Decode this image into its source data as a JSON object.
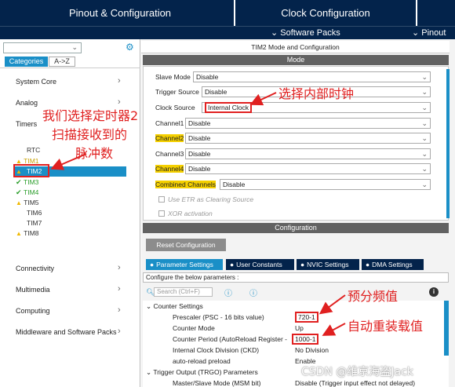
{
  "tabs": {
    "pinout": "Pinout & Configuration",
    "clock": "Clock Configuration"
  },
  "subbar": {
    "software_packs": "Software Packs",
    "pinout": "Pinout"
  },
  "left": {
    "tab_categories": "Categories",
    "tab_az": "A->Z",
    "categories": [
      "System Core",
      "Analog",
      "Timers",
      "Connectivity",
      "Multimedia",
      "Computing",
      "Middleware and Software Packs"
    ],
    "peripherals": [
      {
        "name": "RTC",
        "status": "none"
      },
      {
        "name": "TIM1",
        "status": "warn"
      },
      {
        "name": "TIM2",
        "status": "warn"
      },
      {
        "name": "TIM3",
        "status": "ok"
      },
      {
        "name": "TIM4",
        "status": "ok"
      },
      {
        "name": "TIM5",
        "status": "warn"
      },
      {
        "name": "TIM6",
        "status": "none"
      },
      {
        "name": "TIM7",
        "status": "none"
      },
      {
        "name": "TIM8",
        "status": "warn"
      }
    ]
  },
  "mode": {
    "header": "TIM2 Mode and Configuration",
    "section": "Mode",
    "fields": [
      {
        "label": "Slave Mode",
        "value": "Disable"
      },
      {
        "label": "Trigger Source",
        "value": "Disable"
      },
      {
        "label": "Clock Source",
        "value": "Internal Clock"
      },
      {
        "label": "Channel1",
        "value": "Disable"
      },
      {
        "label": "Channel2",
        "value": "Disable"
      },
      {
        "label": "Channel3",
        "value": "Disable"
      },
      {
        "label": "Channel4",
        "value": "Disable"
      },
      {
        "label": "Combined Channels",
        "value": "Disable"
      }
    ],
    "check1": "Use ETR as Clearing Source",
    "check2": "XOR activation"
  },
  "config": {
    "section": "Configuration",
    "reset": "Reset Configuration",
    "tabs": [
      "Parameter Settings",
      "User Constants",
      "NVIC Settings",
      "DMA Settings"
    ],
    "configure_text": "Configure the below parameters :",
    "search_placeholder": "Search (Ctrl+F)",
    "counter_group": "Counter Settings",
    "params": [
      {
        "label": "Prescaler (PSC - 16 bits value)",
        "value": "720-1"
      },
      {
        "label": "Counter Mode",
        "value": "Up"
      },
      {
        "label": "Counter Period (AutoReload Register -",
        "value": "1000-1"
      },
      {
        "label": "Internal Clock Division (CKD)",
        "value": "No Division"
      },
      {
        "label": "auto-reload preload",
        "value": "Enable"
      }
    ],
    "trigger_group": "Trigger Output (TRGO) Parameters",
    "master_slave": "Master/Slave Mode (MSM bit)",
    "master_slave_value": "Disable (Trigger input effect not delayed)"
  },
  "annotations": {
    "a1": "我们选择定时器2",
    "a2": "扫描接收到的",
    "a3": "脉冲数",
    "a4": "选择内部时钟",
    "a5": "预分频值",
    "a6": "自动重装载值"
  },
  "watermark": "CSDN @维京海盗Jack",
  "colors": {
    "navy": "#03234b",
    "accent": "#1a8fc7",
    "annotation": "#e02020",
    "highlight": "#f5d000"
  }
}
